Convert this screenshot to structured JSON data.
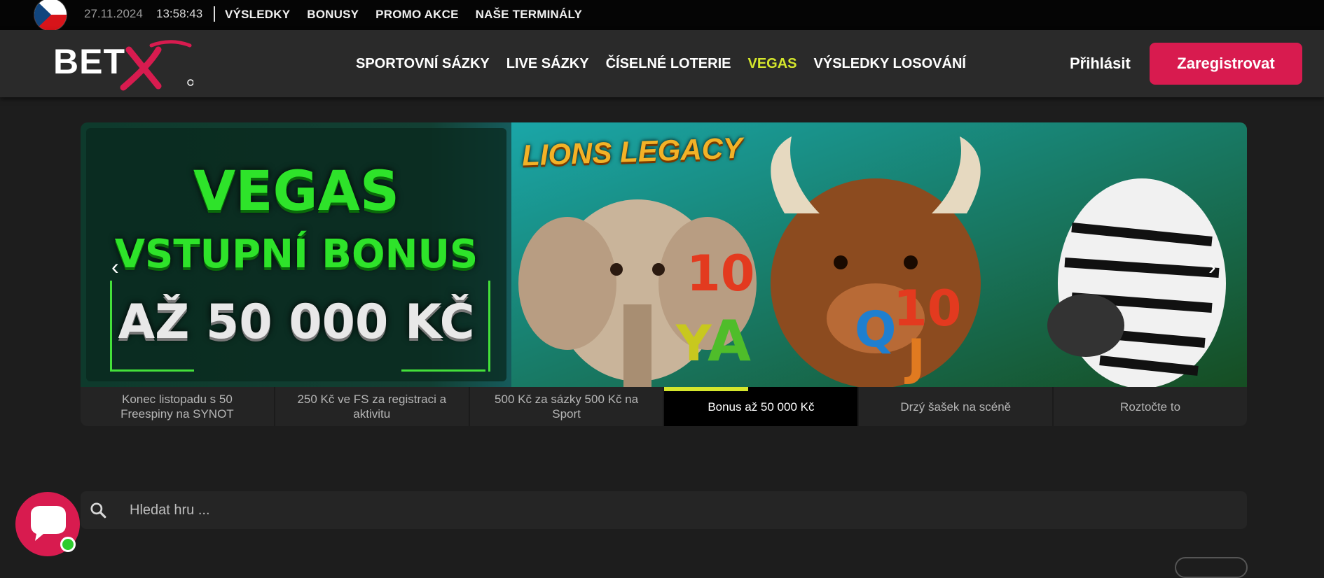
{
  "topbar": {
    "date": "27.11.2024",
    "time": "13:58:43",
    "links": [
      "VÝSLEDKY",
      "BONUSY",
      "PROMO AKCE",
      "NAŠE TERMINÁLY"
    ]
  },
  "header": {
    "logo_text": "BETX",
    "nav": [
      "SPORTOVNÍ SÁZKY",
      "LIVE SÁZKY",
      "ČÍSELNÉ LOTERIE",
      "VEGAS",
      "VÝSLEDKY LOSOVÁNÍ"
    ],
    "active_nav": "VEGAS",
    "login_label": "Přihlásit",
    "register_label": "Zaregistrovat"
  },
  "banner": {
    "line1": "VEGAS",
    "line2": "VSTUPNÍ BONUS",
    "line3": "AŽ 50 000 KČ",
    "game_title": "LIONS LEGACY",
    "prev_icon": "chevron-left-icon",
    "next_icon": "chevron-right-icon"
  },
  "tabs": [
    {
      "label": "Konec listopadu s 50 Freespiny na SYNOT",
      "active": false
    },
    {
      "label": "250 Kč ve FS za registraci a aktivitu",
      "active": false
    },
    {
      "label": "500 Kč za sázky 500 Kč na Sport",
      "active": false
    },
    {
      "label": "Bonus až 50 000 Kč",
      "active": true
    },
    {
      "label": "Drzý šašek na scéně",
      "active": false
    },
    {
      "label": "Roztočte to",
      "active": false
    }
  ],
  "search": {
    "placeholder": "Hledat hru ..."
  },
  "colors": {
    "accent": "#d81b4f",
    "active_nav": "#d4e62c",
    "online": "#2ecc2e"
  }
}
